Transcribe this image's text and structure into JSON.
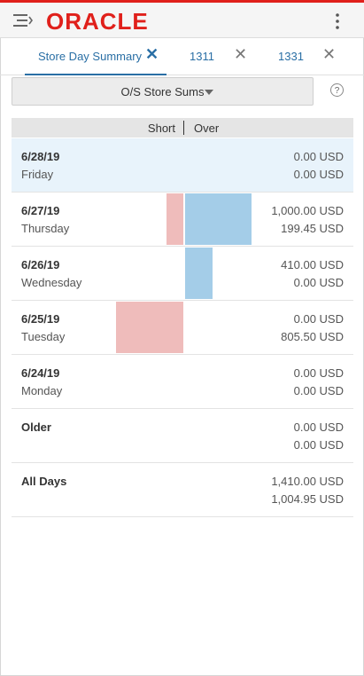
{
  "header": {
    "brand": "ORACLE",
    "brand_color": "#e0201b",
    "accent_color": "#2a6fa5"
  },
  "tabs": [
    {
      "label": "Store Day Summary",
      "active": true
    },
    {
      "label": "1311",
      "active": false
    },
    {
      "label": "1331",
      "active": false
    }
  ],
  "selector": {
    "label": "O/S Store Sums"
  },
  "help": {
    "label": "?"
  },
  "columns": {
    "short": "Short",
    "over": "Over"
  },
  "rows": [
    {
      "date": "6/28/19",
      "day": "Friday",
      "over": "0.00 USD",
      "short": "0.00 USD",
      "over_value": 0,
      "short_value": 0,
      "selected": true
    },
    {
      "date": "6/27/19",
      "day": "Thursday",
      "over": "1,000.00 USD",
      "short": "199.45 USD",
      "over_value": 1000.0,
      "short_value": 199.45,
      "selected": false
    },
    {
      "date": "6/26/19",
      "day": "Wednesday",
      "over": "410.00 USD",
      "short": "0.00 USD",
      "over_value": 410.0,
      "short_value": 0,
      "selected": false
    },
    {
      "date": "6/25/19",
      "day": "Tuesday",
      "over": "0.00 USD",
      "short": "805.50 USD",
      "over_value": 0,
      "short_value": 805.5,
      "selected": false
    },
    {
      "date": "6/24/19",
      "day": "Monday",
      "over": "0.00 USD",
      "short": "0.00 USD",
      "over_value": 0,
      "short_value": 0,
      "selected": false
    },
    {
      "date": "Older",
      "day": "",
      "over": "0.00 USD",
      "short": "0.00 USD",
      "over_value": 0,
      "short_value": 0,
      "selected": false
    },
    {
      "date": "All Days",
      "day": "",
      "over": "1,410.00 USD",
      "short": "1,004.95 USD",
      "over_value": 1410.0,
      "short_value": 1004.95,
      "selected": false
    }
  ]
}
